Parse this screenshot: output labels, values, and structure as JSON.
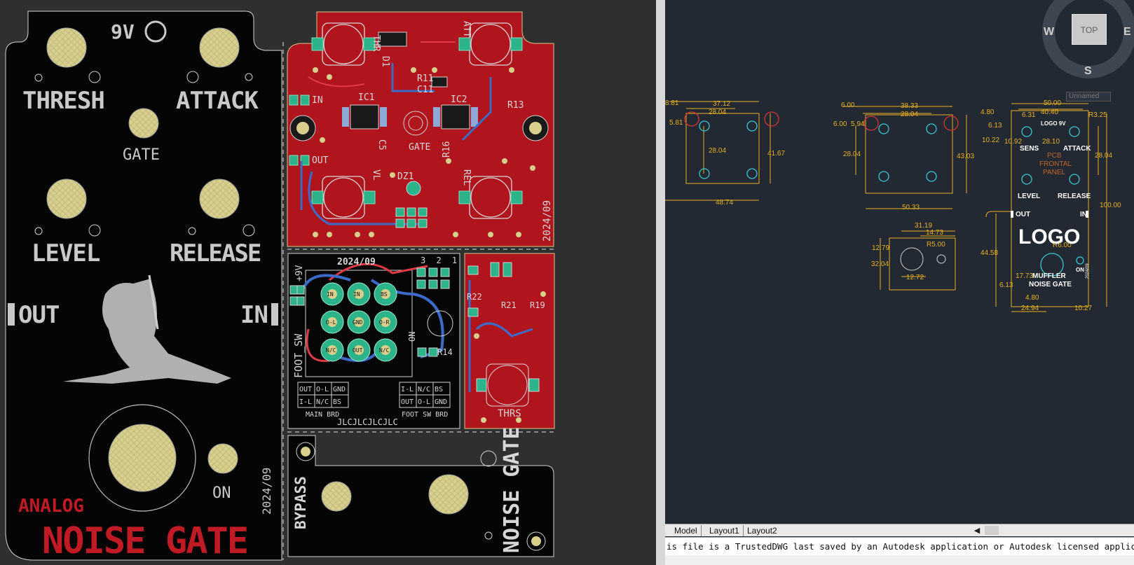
{
  "pcb": {
    "panel": {
      "logo_9v": "9V",
      "thresh": "THRESH",
      "attack": "ATTACK",
      "gate": "GATE",
      "level": "LEVEL",
      "release": "RELEASE",
      "out": "OUT",
      "in": "IN",
      "on": "ON",
      "date": "2024/09",
      "analog": "ANALOG",
      "title": "NOISE GATE"
    },
    "board_red": {
      "thr": "THR",
      "att": "ATT",
      "vl": "VL",
      "rel": "REL",
      "in": "IN",
      "out": "OUT",
      "gate": "GATE",
      "dz1": "DZ1",
      "r11": "R11",
      "c11": "C11",
      "ic1": "IC1",
      "ic2": "IC2",
      "c5": "C5",
      "r16": "R16",
      "r13": "R13",
      "d1": "D1",
      "date": "2024/09"
    },
    "foot_board": {
      "date": "2024/09",
      "pins": "3 2 1",
      "voltage": "+9V",
      "foot_sw": "FOOT_SW",
      "on": "ON",
      "r14": "R14",
      "pad_row1": [
        "IN",
        "IN",
        "BS"
      ],
      "pad_row2": [
        "O-L",
        "GND",
        "O-R"
      ],
      "pad_row3": [
        "N/C",
        "OUT",
        "N/C"
      ],
      "main_grid": [
        "OUT",
        "O-L",
        "GND",
        "I-L",
        "N/C",
        "BS"
      ],
      "main_brd": "MAIN BRD",
      "foot_grid": [
        "I-L",
        "N/C",
        "BS",
        "OUT",
        "O-L",
        "GND"
      ],
      "foot_sw_brd": "FOOT SW BRD",
      "jlc": "JLCJLCJLCJLC"
    },
    "sens_board": {
      "thrs": "THRS",
      "r22": "R22",
      "r21": "R21",
      "r19": "R19"
    },
    "bypass_board": {
      "bypass": "BYPASS",
      "title": "NOISE GATE"
    }
  },
  "cad": {
    "viewcube": {
      "top": "TOP",
      "w": "W",
      "e": "E",
      "s": "S"
    },
    "ucs": "Unnamed",
    "drawing1": {
      "d1": "8.81",
      "d2": "37.12",
      "d3": "28.04",
      "d4": "5.81",
      "d5": "28.04",
      "d6": "41.67",
      "d7": "48.74"
    },
    "drawing2": {
      "d1": "6.00",
      "d2": "38.33",
      "d3": "28.04",
      "d4": "6.00",
      "d5": "5.94",
      "d6": "28.04",
      "d7": "43.03",
      "d8": "50.33"
    },
    "drawing3": {
      "d1": "31.19",
      "d2": "14.73",
      "d3": "12.79",
      "d4": "R5.00",
      "d5": "32.04",
      "d6": "12.72"
    },
    "drawing4": {
      "d_50": "50.00",
      "d_4040": "40.40",
      "d_480": "4.80",
      "d_631": "6.31",
      "r325": "R3.25",
      "d_613": "6.13",
      "d_1022": "10.22",
      "d_1092": "10.92",
      "d_2810": "28.10",
      "d_2804": "28.04",
      "d_100": "100.00",
      "d_4458": "44.58",
      "r600": "R6.00",
      "d_1773": "17.73",
      "d_613b": "6.13",
      "d_480b": "4.80",
      "d_2494": "24.94",
      "d_1027": "10.27",
      "logo9v": "LOGO 9V",
      "sens": "SENS",
      "attack": "ATTACK",
      "pcb": "PCB",
      "frontal": "FRONTAL",
      "panel": "PANEL",
      "level": "LEVEL",
      "release": "RELEASE",
      "out": "OUT",
      "in": "IN",
      "logo": "LOGO",
      "on": "ON",
      "muffler": "MUFFLER",
      "noise_gate": "NOISE GATE",
      "date": "2024/09"
    },
    "tabs": [
      "Model",
      "Layout1",
      "Layout2"
    ],
    "command_line": "is file is a TrustedDWG last saved by an Autodesk application or Autodesk licensed application."
  },
  "colors": {
    "pcb_red": "#b0141c",
    "silk": "#c8c8c8",
    "cad_bg": "#222933",
    "dim_yellow": "#e8b020",
    "cyan": "#39c7d1"
  }
}
